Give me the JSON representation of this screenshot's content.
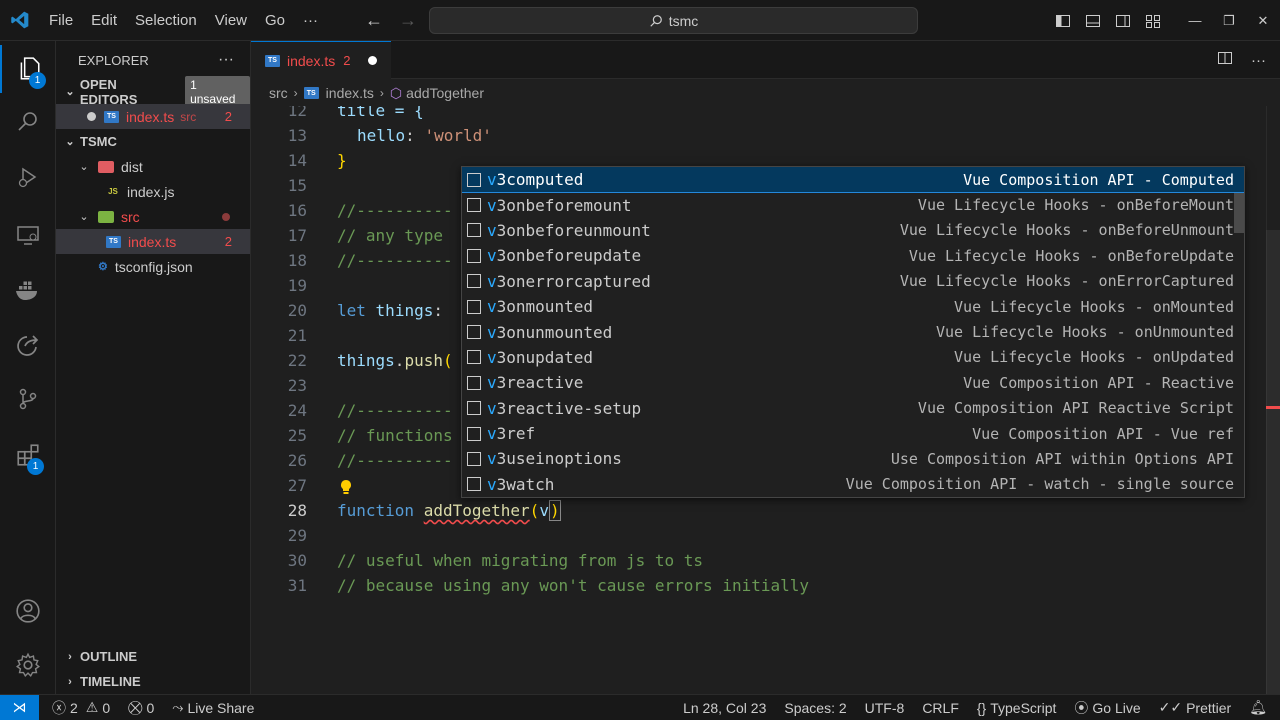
{
  "menu": [
    "File",
    "Edit",
    "Selection",
    "View",
    "Go",
    "···"
  ],
  "search": {
    "text": "tsmc"
  },
  "explorer": {
    "title": "EXPLORER",
    "open_editors": "OPEN EDITORS",
    "unsaved_badge": "1 unsaved",
    "open_file": {
      "name": "index.ts",
      "folder": "src",
      "count": "2"
    },
    "project": "TSMC",
    "tree": [
      {
        "label": "dist"
      },
      {
        "label": "index.js"
      },
      {
        "label": "src"
      },
      {
        "label": "index.ts",
        "count": "2"
      },
      {
        "label": "tsconfig.json"
      }
    ],
    "outline": "OUTLINE",
    "timeline": "TIMELINE"
  },
  "activity_badges": {
    "explorer": "1",
    "extensions": "1"
  },
  "tab": {
    "name": "index.ts",
    "count": "2",
    "icon": "TS"
  },
  "breadcrumb": {
    "folder": "src",
    "file": "index.ts",
    "symbol": "addTogether"
  },
  "code": {
    "lines": [
      {
        "n": "12",
        "text": "title = {"
      },
      {
        "n": "13",
        "text": "hello: 'world'"
      },
      {
        "n": "14",
        "text": "}"
      },
      {
        "n": "15",
        "text": ""
      },
      {
        "n": "16",
        "text": "//----------"
      },
      {
        "n": "17",
        "text": "// any type"
      },
      {
        "n": "18",
        "text": "//----------"
      },
      {
        "n": "19",
        "text": ""
      },
      {
        "n": "20",
        "text": "let things:"
      },
      {
        "n": "21",
        "text": ""
      },
      {
        "n": "22",
        "text": "things.push("
      },
      {
        "n": "23",
        "text": ""
      },
      {
        "n": "24",
        "text": "//----------"
      },
      {
        "n": "25",
        "text": "// functions"
      },
      {
        "n": "26",
        "text": "//----------"
      },
      {
        "n": "27",
        "text": ""
      },
      {
        "n": "28",
        "text": "function addTogether(v)"
      },
      {
        "n": "29",
        "text": ""
      },
      {
        "n": "30",
        "text": "// useful when migrating from js to ts"
      },
      {
        "n": "31",
        "text": "// because using any won't cause errors initially"
      }
    ]
  },
  "suggestions": [
    {
      "prefix": "v",
      "rest": "3computed",
      "desc": "Vue Composition API - Computed"
    },
    {
      "prefix": "v",
      "rest": "3onbeforemount",
      "desc": "Vue Lifecycle Hooks - onBeforeMount"
    },
    {
      "prefix": "v",
      "rest": "3onbeforeunmount",
      "desc": "Vue Lifecycle Hooks - onBeforeUnmount"
    },
    {
      "prefix": "v",
      "rest": "3onbeforeupdate",
      "desc": "Vue Lifecycle Hooks - onBeforeUpdate"
    },
    {
      "prefix": "v",
      "rest": "3onerrorcaptured",
      "desc": "Vue Lifecycle Hooks - onErrorCaptured"
    },
    {
      "prefix": "v",
      "rest": "3onmounted",
      "desc": "Vue Lifecycle Hooks - onMounted"
    },
    {
      "prefix": "v",
      "rest": "3onunmounted",
      "desc": "Vue Lifecycle Hooks - onUnmounted"
    },
    {
      "prefix": "v",
      "rest": "3onupdated",
      "desc": "Vue Lifecycle Hooks - onUpdated"
    },
    {
      "prefix": "v",
      "rest": "3reactive",
      "desc": "Vue Composition API - Reactive"
    },
    {
      "prefix": "v",
      "rest": "3reactive-setup",
      "desc": "Vue Composition API Reactive Script"
    },
    {
      "prefix": "v",
      "rest": "3ref",
      "desc": "Vue Composition API - Vue ref"
    },
    {
      "prefix": "v",
      "rest": "3useinoptions",
      "desc": "Use Composition API within Options API"
    },
    {
      "prefix": "v",
      "rest": "3watch",
      "desc": "Vue Composition API - watch - single source"
    }
  ],
  "status": {
    "errors": "2",
    "warnings": "0",
    "ports": "0",
    "live_share": "Live Share",
    "position": "Ln 28, Col 23",
    "spaces": "Spaces: 2",
    "encoding": "UTF-8",
    "eol": "CRLF",
    "language": "TypeScript",
    "go_live": "Go Live",
    "prettier": "Prettier"
  },
  "colors": {
    "accent": "#0078d4",
    "error": "#f14c4c",
    "match": "#2aaaff"
  }
}
